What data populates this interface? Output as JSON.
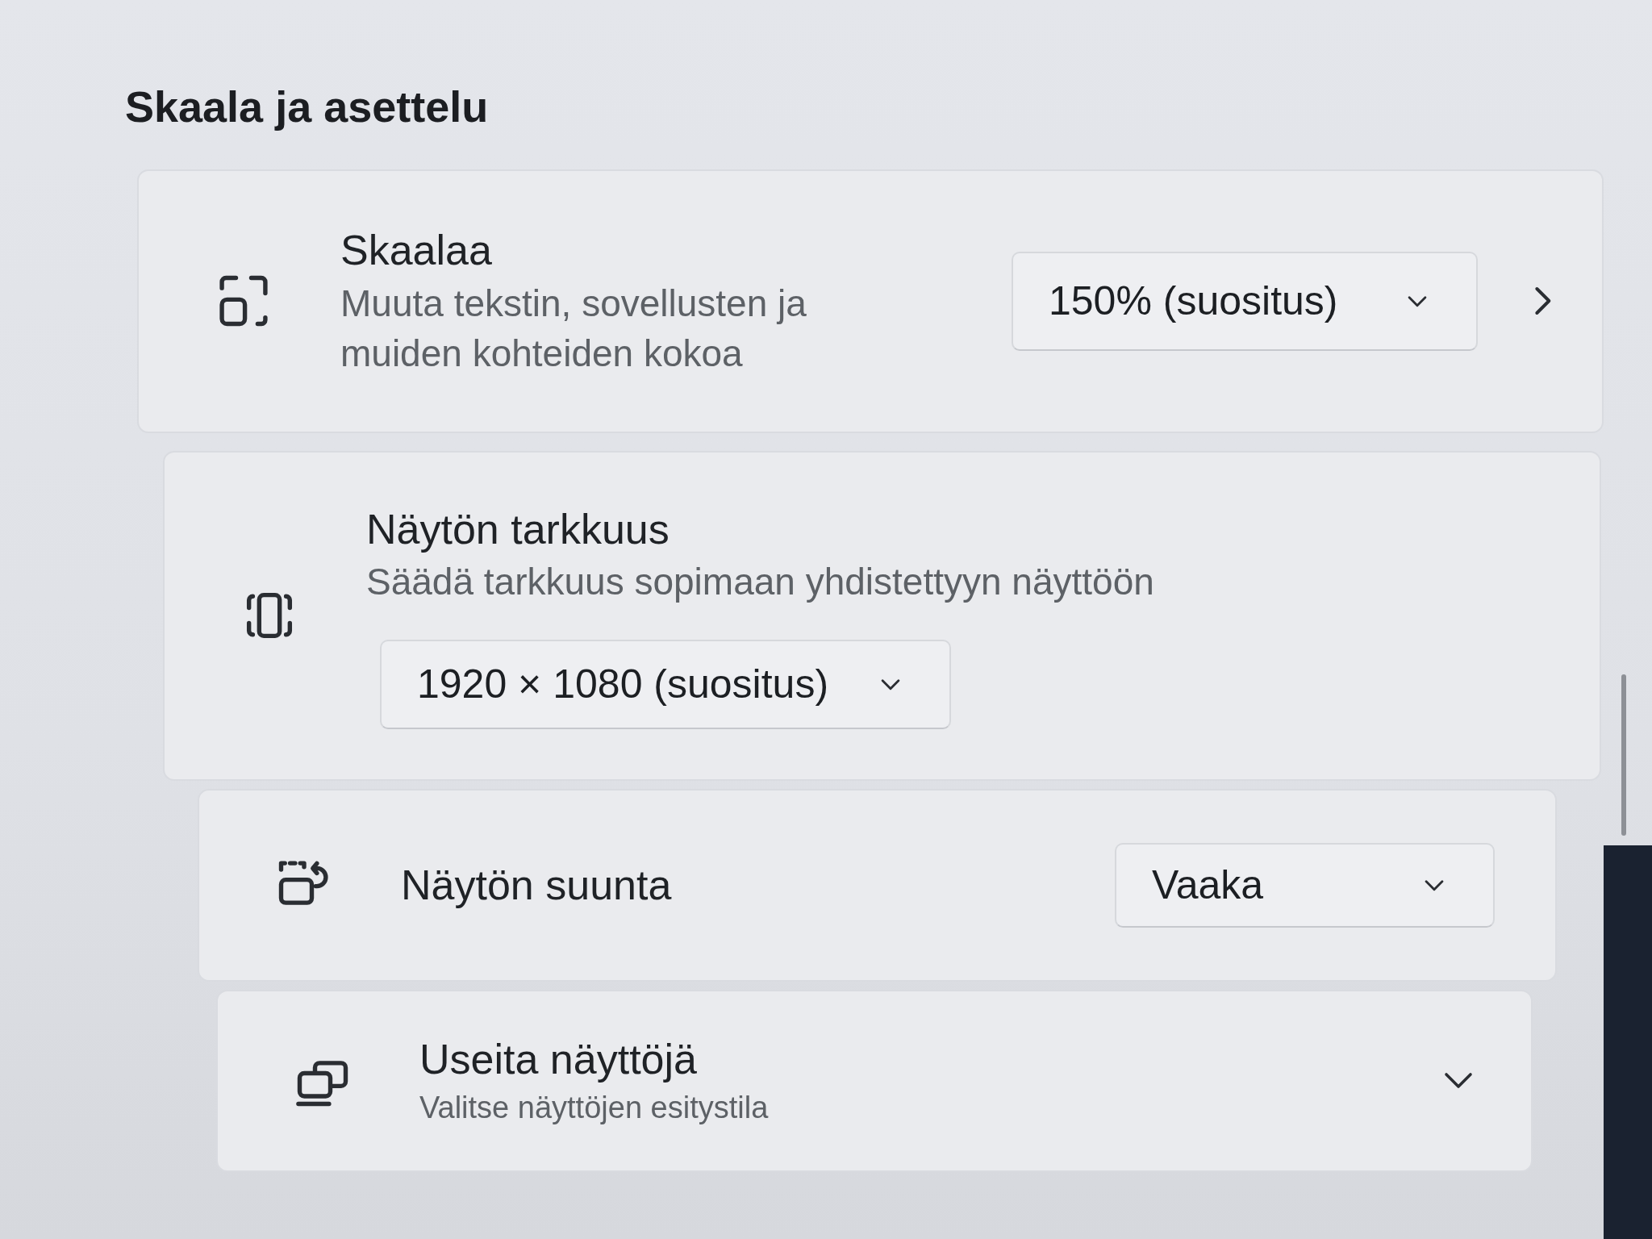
{
  "section_title": "Skaala ja asettelu",
  "settings": [
    {
      "kind": "inline",
      "title": "Skaalaa",
      "description": "Muuta tekstin, sovellusten ja muiden kohteiden kokoa",
      "dropdown": "150% (suositus)",
      "navigable": true
    },
    {
      "kind": "stacked",
      "title": "Näytön tarkkuus",
      "description": "Säädä tarkkuus sopimaan yhdistettyyn näyttöön",
      "dropdown": "1920 × 1080 (suositus)"
    },
    {
      "kind": "inline",
      "title": "Näytön suunta",
      "dropdown": "Vaaka",
      "navigable": false
    },
    {
      "kind": "expander",
      "title": "Useita näyttöjä",
      "description": "Valitse näyttöjen esitystila",
      "expanded": false
    }
  ]
}
